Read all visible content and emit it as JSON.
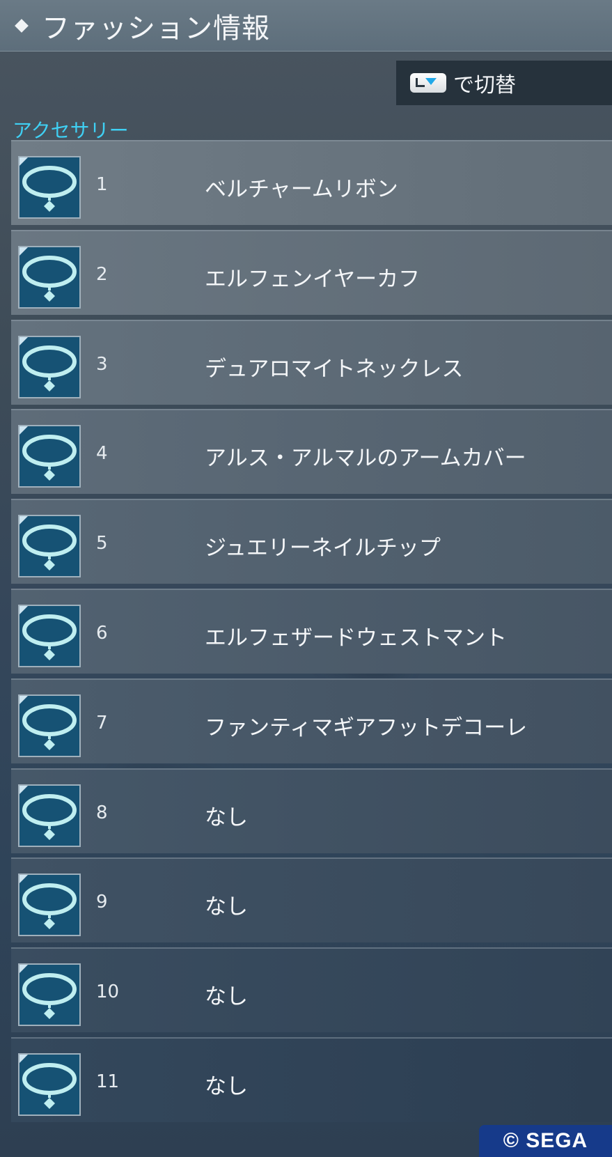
{
  "header": {
    "title": "ファッション情報"
  },
  "switch": {
    "button_icon": "lb-button-icon",
    "label": "で切替"
  },
  "section": {
    "label": "アクセサリー"
  },
  "items": [
    {
      "number": "1",
      "name": "ベルチャームリボン"
    },
    {
      "number": "2",
      "name": "エルフェンイヤーカフ"
    },
    {
      "number": "3",
      "name": "デュアロマイトネックレス"
    },
    {
      "number": "4",
      "name": "アルス・アルマルのアームカバー"
    },
    {
      "number": "5",
      "name": "ジュエリーネイルチップ"
    },
    {
      "number": "6",
      "name": "エルフェザードウェストマント"
    },
    {
      "number": "7",
      "name": "ファンティマギアフットデコーレ"
    },
    {
      "number": "8",
      "name": "なし"
    },
    {
      "number": "9",
      "name": "なし"
    },
    {
      "number": "10",
      "name": "なし"
    },
    {
      "number": "11",
      "name": "なし"
    }
  ],
  "copyright": "© SEGA",
  "colors": {
    "accent_cyan": "#3fd0f4",
    "icon_bg": "#165274",
    "icon_stroke": "#bfeef0",
    "sega_blue": "#163a8a"
  }
}
